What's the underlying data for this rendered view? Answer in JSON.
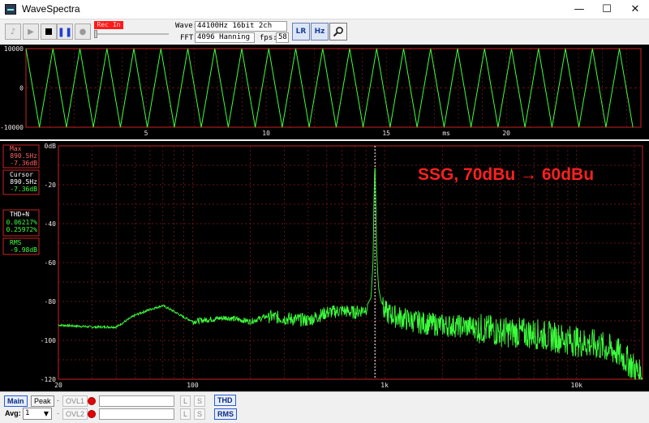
{
  "window": {
    "title": "WaveSpectra",
    "minimize": "—",
    "maximize": "☐",
    "close": "✕"
  },
  "toolbar": {
    "rec_label": "Rec In",
    "wave_label": "Wave:",
    "wave_value": "44100Hz 16bit 2ch",
    "fft_label": "FFT:",
    "fft_value": "4096 Hanning",
    "fps_label": "fps:",
    "fps_value": "58",
    "lr_button": "LR",
    "hz_button": "Hz"
  },
  "panels": {
    "max_label": "Max",
    "max_freq": "890.5Hz",
    "max_db": "-7.36dB",
    "cursor_label": "Cursor",
    "cursor_freq": "890.5Hz",
    "cursor_db": "-7.36dB",
    "thd_label": "THD+N",
    "thd_val1": "0.06217%",
    "thd_val2": "0.25972%",
    "rms_label": "RMS",
    "rms_val": "-9.98dB"
  },
  "annotation": "SSG, 70dBu → 60dBu",
  "bottom": {
    "main_button": "Main",
    "peak_button": "Peak",
    "ovl1": "OVL1",
    "ovl2": "OVL2",
    "l1": "L",
    "s1": "S",
    "l2": "L",
    "s2": "S",
    "avg_label": "Avg:",
    "avg_value": "1",
    "thd_button": "THD",
    "rms_button": "RMS"
  },
  "colors": {
    "trace": "#3cff3c",
    "grid": "#8b1a1a",
    "axis_text": "#f0e6e6",
    "annotation": "#ff2020",
    "frame": "#cc2222"
  },
  "chart_data": [
    {
      "type": "line",
      "name_hint": "waveform",
      "x": [
        0,
        25.6
      ],
      "xticks": [
        "5",
        "10",
        "15",
        "20"
      ],
      "xtick_values": [
        5,
        10,
        15,
        20
      ],
      "xunit": "ms",
      "yticks": [
        "10000",
        "0",
        "-10000"
      ],
      "ytick_values": [
        10000,
        0,
        -10000
      ],
      "ylim": [
        -10000,
        10000
      ],
      "xlim": [
        0,
        25.6
      ],
      "signal": {
        "frequency_hz": 890.5,
        "amplitude": 10000,
        "shape": "triangle"
      }
    },
    {
      "type": "line",
      "name_hint": "spectrum",
      "xscale": "log",
      "xlim": [
        20,
        22050
      ],
      "ylim": [
        -120,
        0
      ],
      "xticks": [
        "20",
        "100",
        "1k",
        "10k"
      ],
      "xtick_values": [
        20,
        100,
        1000,
        10000
      ],
      "yticks": [
        "0dB",
        "-20",
        "-40",
        "-60",
        "-80",
        "-100",
        "-120"
      ],
      "ytick_values": [
        0,
        -20,
        -40,
        -60,
        -80,
        -100,
        -120
      ],
      "x": [
        20,
        30,
        40,
        50,
        60,
        70,
        80,
        90,
        100,
        120,
        150,
        200,
        250,
        300,
        400,
        500,
        600,
        700,
        800,
        850,
        870,
        880,
        890.5,
        900,
        910,
        930,
        960,
        1000,
        1100,
        1300,
        1600,
        2000,
        3000,
        4000,
        6000,
        8000,
        10000,
        13000,
        16000,
        19000,
        22050
      ],
      "y": [
        -92,
        -93,
        -93,
        -87,
        -84,
        -82,
        -85,
        -88,
        -90,
        -89,
        -88,
        -90,
        -87,
        -88,
        -89,
        -85,
        -84,
        -85,
        -83,
        -78,
        -60,
        -30,
        -7.36,
        -30,
        -55,
        -73,
        -80,
        -84,
        -86,
        -88,
        -90,
        -91,
        -92,
        -94,
        -95,
        -97,
        -99,
        -101,
        -104,
        -110,
        -118
      ]
    }
  ]
}
